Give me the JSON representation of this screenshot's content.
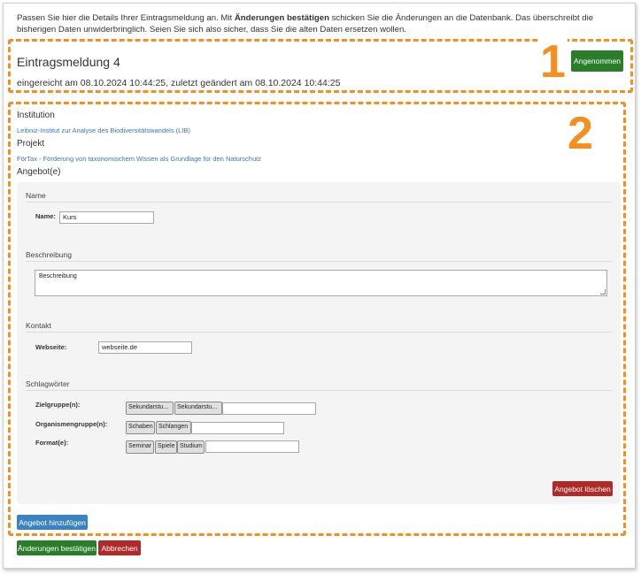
{
  "intro": {
    "part1": "Passen Sie hier die Details Ihrer Eintragsmeldung an. Mit ",
    "bold": "Änderungen bestätigen",
    "part2": " schicken Sie die Änderungen an die Datenbank. Das überschreibt die bisherigen Daten unwiderbringlich. Seien Sie sich also sicher, dass Sie die alten Daten ersetzen wollen."
  },
  "callouts": {
    "one": "1",
    "two": "2"
  },
  "entry": {
    "title": "Eintragsmeldung 4",
    "status_button": "Angenommen",
    "meta": "eingereicht am 08.10.2024 10:44:25, zuletzt geändert am 08.10.2024 10:44:25"
  },
  "institution": {
    "label": "Institution",
    "value": "Leibniz-Institut zur Analyse des Biodiversitätswandels (LIB)"
  },
  "project": {
    "label": "Projekt",
    "value": "FörTax - Förderung von taxonomischem Wissen als Grundlage für den Naturschutz"
  },
  "offers_label": "Angebot(e)",
  "offer": {
    "name_section": "Name",
    "name_label": "Name:",
    "name_value": "Kurs",
    "desc_section": "Beschreibung",
    "desc_value": "Beschreibung",
    "contact_section": "Kontakt",
    "website_label": "Webseite:",
    "website_value": "webseite.de",
    "keywords_section": "Schlagwörter",
    "target_label": "Zielgruppe(n):",
    "target_tags": [
      "Sekundarstu...",
      "Sekundarstu..."
    ],
    "organism_label": "Organismengruppe(n):",
    "organism_tags": [
      "Schaben",
      "Schlangen"
    ],
    "format_label": "Format(e):",
    "format_tags": [
      "Seminar",
      "Spiele",
      "Studium"
    ],
    "delete_button": "Angebot löschen"
  },
  "add_offer_button": "Angebot hinzufügen",
  "confirm_button": "Änderungen bestätigen",
  "cancel_button": "Abbrechen",
  "colors": {
    "accent_orange": "#f39020",
    "success_green": "#2a7d2a",
    "danger_red": "#b02a2a",
    "primary_blue": "#3a82c0"
  }
}
